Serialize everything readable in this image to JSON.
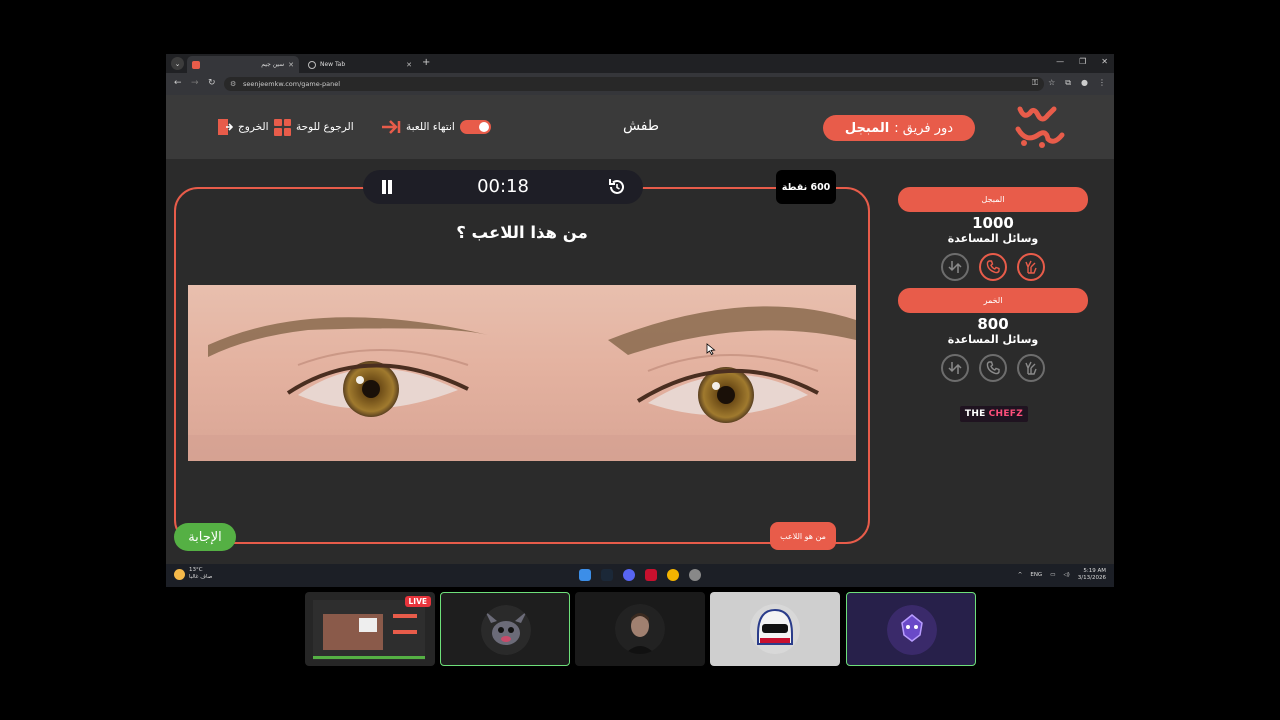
{
  "browser": {
    "tabs": [
      {
        "title": "سين جيم",
        "active": true
      },
      {
        "title": "New Tab",
        "active": false
      }
    ],
    "url": "seenjeemkw.com/game-panel"
  },
  "game": {
    "turn_prefix": "دور فريق :",
    "turn_team": "المبجل",
    "category": "طفش",
    "controls": {
      "end_game": "انتهاء اللعبة",
      "back_to_board": "الرجوع للوحة",
      "exit": "الخروج"
    },
    "timer": "00:18",
    "points": "600 نقطة",
    "question": "من هذا اللاعب ؟",
    "answer_button": "الإجابة",
    "hint_button": "من هو اللاعب"
  },
  "teams": [
    {
      "name": "المبجل",
      "score": "1000",
      "aids_label": "وسائل المساعدة"
    },
    {
      "name": "الخمر",
      "score": "800",
      "aids_label": "وسائل المساعدة"
    }
  ],
  "sponsor": {
    "the": "THE",
    "chefz": "CHEFZ"
  },
  "taskbar": {
    "temperature": "13°C",
    "weather": "صاف غالبا",
    "lang": "ENG",
    "time": "5:19 AM",
    "date": "3/13/2026"
  },
  "stream": {
    "live_badge": "LIVE"
  },
  "colors": {
    "accent": "#e85c4a",
    "answer_green": "#55b044",
    "page_bg": "#2b2b2b",
    "topbar_bg": "#3a3a3a"
  }
}
